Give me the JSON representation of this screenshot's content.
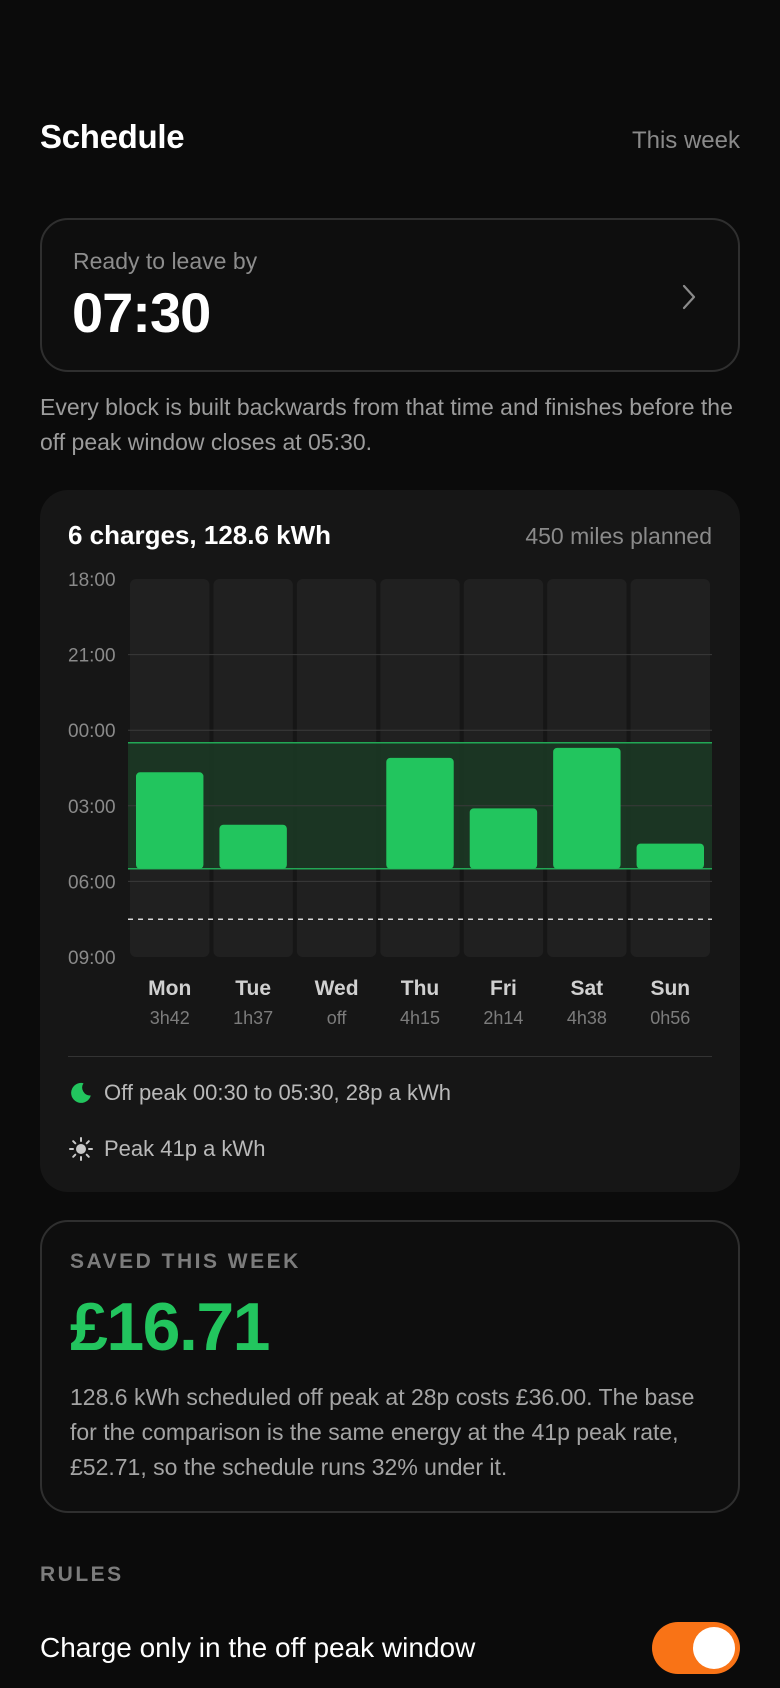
{
  "header": {
    "title": "Schedule",
    "period": "This week"
  },
  "leave": {
    "label": "Ready to leave by",
    "time": "07:30",
    "icon": "chevron-right-icon"
  },
  "explanation": "Every block is built backwards from that time and finishes before the off peak window closes at 05:30.",
  "summary": {
    "title": "6 charges, 128.6 kWh",
    "miles": "450 miles planned"
  },
  "chart_data": {
    "type": "bar",
    "categories": [
      "Mon",
      "Tue",
      "Wed",
      "Thu",
      "Fri",
      "Sat",
      "Sun"
    ],
    "durations": [
      "3h42",
      "1h37",
      "off",
      "4h15",
      "2h14",
      "4h38",
      "0h56"
    ],
    "y_ticks": [
      "18:00",
      "21:00",
      "00:00",
      "03:00",
      "06:00",
      "09:00"
    ],
    "y_range_hours": [
      18,
      33
    ],
    "blocks": [
      {
        "start": 25.67,
        "end": 29.5
      },
      {
        "start": 27.75,
        "end": 29.5
      },
      null,
      {
        "start": 25.1,
        "end": 29.5
      },
      {
        "start": 27.1,
        "end": 29.5
      },
      {
        "start": 24.7,
        "end": 29.5
      },
      {
        "start": 28.5,
        "end": 29.5
      }
    ],
    "offpeak_window": [
      24.5,
      29.5
    ],
    "leave_marker": 31.5,
    "colors": {
      "bar": "#22c55e",
      "offpeak_band": "#1b3a25",
      "column": "#202020"
    }
  },
  "legend": {
    "offpeak": {
      "icon": "moon-icon",
      "label": "Off peak 00:30 to 05:30, 28p a kWh"
    },
    "peak": {
      "icon": "sun-icon",
      "label": "Peak 41p a kWh"
    }
  },
  "savings": {
    "label": "SAVED THIS WEEK",
    "amount": "£16.71",
    "detail": "128.6 kWh scheduled off peak at 28p costs £36.00. The base for the comparison is the same energy at the 41p peak rate, £52.71, so the schedule runs 32% under it."
  },
  "rules": {
    "label": "RULES",
    "items": [
      {
        "label": "Charge only in the off peak window",
        "enabled": true
      }
    ]
  },
  "colors": {
    "accent": "#22c55e",
    "toggle": "#f97316"
  }
}
